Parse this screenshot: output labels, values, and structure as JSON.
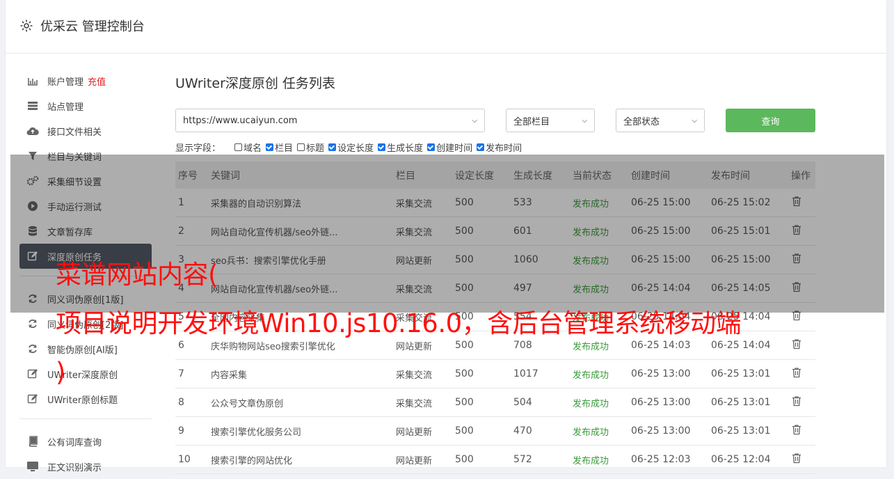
{
  "app": {
    "title": "优采云 管理控制台",
    "icon": "gear-icon"
  },
  "sidebar": {
    "items": [
      {
        "label": "账户管理",
        "badge": "充值",
        "icon": "bar-chart-icon"
      },
      {
        "label": "站点管理",
        "icon": "server-icon"
      },
      {
        "label": "接口文件相关",
        "icon": "cloud-upload-icon"
      },
      {
        "label": "栏目与关键词",
        "icon": "filter-icon"
      },
      {
        "label": "采集细节设置",
        "icon": "gears-icon"
      },
      {
        "label": "手动运行测试",
        "icon": "play-circle-icon"
      },
      {
        "label": "文章暂存库",
        "icon": "database-icon"
      },
      {
        "label": "深度原创任务",
        "icon": "edit-icon",
        "active": true
      },
      {
        "label": "同义词伪原创[1版]",
        "icon": "refresh-icon"
      },
      {
        "label": "同义词伪原创[2版]",
        "icon": "refresh-icon"
      },
      {
        "label": "智能伪原创[AI版]",
        "icon": "refresh-icon"
      },
      {
        "label": "UWriter深度原创",
        "icon": "edit-icon"
      },
      {
        "label": "UWriter原创标题",
        "icon": "edit-icon"
      },
      {
        "label": "公有词库查询",
        "icon": "book-icon"
      },
      {
        "label": "正文识别演示",
        "icon": "monitor-icon"
      }
    ]
  },
  "main": {
    "title": "UWriter深度原创 任务列表",
    "site_select": "https://www.ucaiyun.com",
    "column_select": "全部栏目",
    "status_select": "全部状态",
    "query_button": "查询",
    "fields_label": "显示字段：",
    "fields": [
      {
        "label": "域名",
        "checked": false
      },
      {
        "label": "栏目",
        "checked": true
      },
      {
        "label": "标题",
        "checked": false
      },
      {
        "label": "设定长度",
        "checked": true
      },
      {
        "label": "生成长度",
        "checked": true
      },
      {
        "label": "创建时间",
        "checked": true
      },
      {
        "label": "发布时间",
        "checked": true
      }
    ],
    "table": {
      "headers": [
        "序号",
        "关键词",
        "栏目",
        "设定长度",
        "生成长度",
        "当前状态",
        "创建时间",
        "发布时间",
        "操作"
      ],
      "rows": [
        [
          "1",
          "采集器的自动识别算法",
          "采集交流",
          "500",
          "533",
          "发布成功",
          "06-25 15:00",
          "06-25 15:02"
        ],
        [
          "2",
          "网站自动化宣传机器/seo外链...",
          "采集交流",
          "500",
          "601",
          "发布成功",
          "06-25 15:00",
          "06-25 15:01"
        ],
        [
          "3",
          "seo兵书：搜索引擎优化手册",
          "网站更新",
          "500",
          "1060",
          "发布成功",
          "06-25 15:00",
          "06-25 15:00"
        ],
        [
          "4",
          "网站自动化宣传机器/seo外链...",
          "采集交流",
          "500",
          "497",
          "发布成功",
          "06-25 14:04",
          "06-25 14:05"
        ],
        [
          "5",
          "全网内容采集",
          "采集交流",
          "500",
          "554",
          "发布成功",
          "06-25 14:04",
          "06-25 14:04"
        ],
        [
          "6",
          "庆华购物网站seo搜索引擎优化",
          "网站更新",
          "500",
          "708",
          "发布成功",
          "06-25 14:03",
          "06-25 14:04"
        ],
        [
          "7",
          "内容采集",
          "采集交流",
          "500",
          "1017",
          "发布成功",
          "06-25 13:00",
          "06-25 13:01"
        ],
        [
          "8",
          "公众号文章伪原创",
          "采集交流",
          "500",
          "504",
          "发布成功",
          "06-25 13:00",
          "06-25 13:01"
        ],
        [
          "9",
          "搜索引擎优化服务公司",
          "网站更新",
          "500",
          "470",
          "发布成功",
          "06-25 13:00",
          "06-25 13:01"
        ],
        [
          "10",
          "搜索引擎的网站优化",
          "网站更新",
          "500",
          "572",
          "发布成功",
          "06-25 12:03",
          "06-25 12:04"
        ]
      ]
    }
  },
  "watermark": "菜谱网站内容(\n项目说明开发环境Win10.js10.16.0，含后台管理系统移动端\n)",
  "colors": {
    "query_button": "#5cb85c",
    "status_ok": "#3a9a3a",
    "badge": "#e02020",
    "active_item": "#555a66",
    "watermark": "#ff1010"
  }
}
